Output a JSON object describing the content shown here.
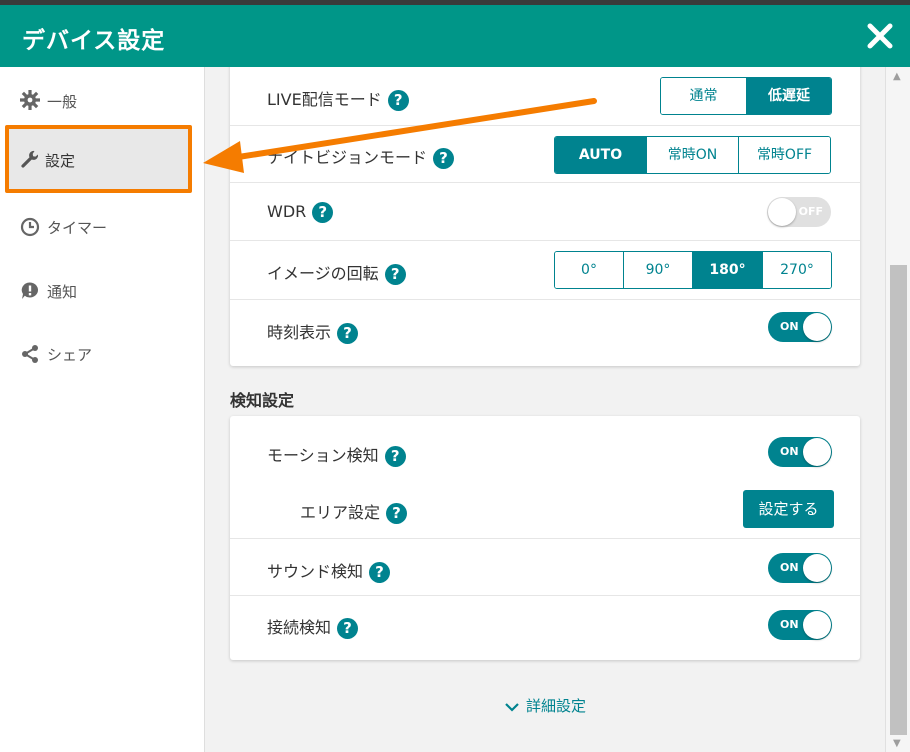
{
  "window": {
    "title": "デバイス設定"
  },
  "sidebar": {
    "items": [
      {
        "label": "一般",
        "icon": "gear-icon"
      },
      {
        "label": "設定",
        "icon": "wrench-icon",
        "active": true
      },
      {
        "label": "タイマー",
        "icon": "clock-icon"
      },
      {
        "label": "通知",
        "icon": "alert-bubble-icon"
      },
      {
        "label": "シェア",
        "icon": "share-icon"
      }
    ]
  },
  "camera_settings": {
    "live_mode": {
      "label": "LIVE配信モード",
      "options": [
        "通常",
        "低遅延"
      ],
      "selected": "低遅延"
    },
    "night_vision": {
      "label": "ナイトビジョンモード",
      "options": [
        "AUTO",
        "常時ON",
        "常時OFF"
      ],
      "selected": "AUTO"
    },
    "wdr": {
      "label": "WDR",
      "state": "OFF"
    },
    "rotation": {
      "label": "イメージの回転",
      "options": [
        "0°",
        "90°",
        "180°",
        "270°"
      ],
      "selected": "180°"
    },
    "time_display": {
      "label": "時刻表示",
      "state": "ON"
    }
  },
  "detection": {
    "section_title": "検知設定",
    "motion": {
      "label": "モーション検知",
      "state": "ON"
    },
    "area": {
      "label": "エリア設定",
      "button": "設定する"
    },
    "sound": {
      "label": "サウンド検知",
      "state": "ON"
    },
    "connection": {
      "label": "接続検知",
      "state": "ON"
    }
  },
  "advanced_link": "詳細設定",
  "colors": {
    "header": "#009688",
    "accent": "#00838f",
    "highlight_border": "#f57c00",
    "arrow": "#f57c00"
  }
}
